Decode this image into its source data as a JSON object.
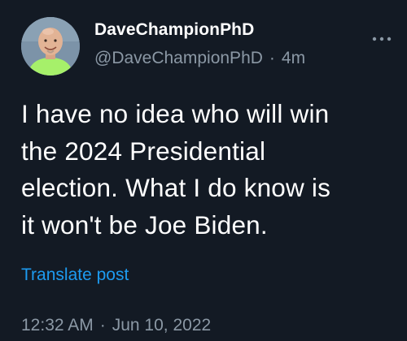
{
  "author": {
    "display_name": "DaveChampionPhD",
    "handle": "@DaveChampionPhD",
    "relative_time": "4m",
    "avatar": "profile-avatar"
  },
  "separator": "·",
  "post": {
    "text": "I have no idea who will win\nthe 2024 Presidential\nelection. What I do know is\nit won't be Joe Biden."
  },
  "translate_label": "Translate post",
  "meta": {
    "time": "12:32 AM",
    "date": "Jun 10, 2022"
  },
  "icons": {
    "more": "more-options-icon"
  },
  "colors": {
    "background": "#131a24",
    "text": "#ffffff",
    "secondary_text": "#8b98a5",
    "link": "#1d9bf0",
    "avatar_shirt": "#a6f06a"
  }
}
